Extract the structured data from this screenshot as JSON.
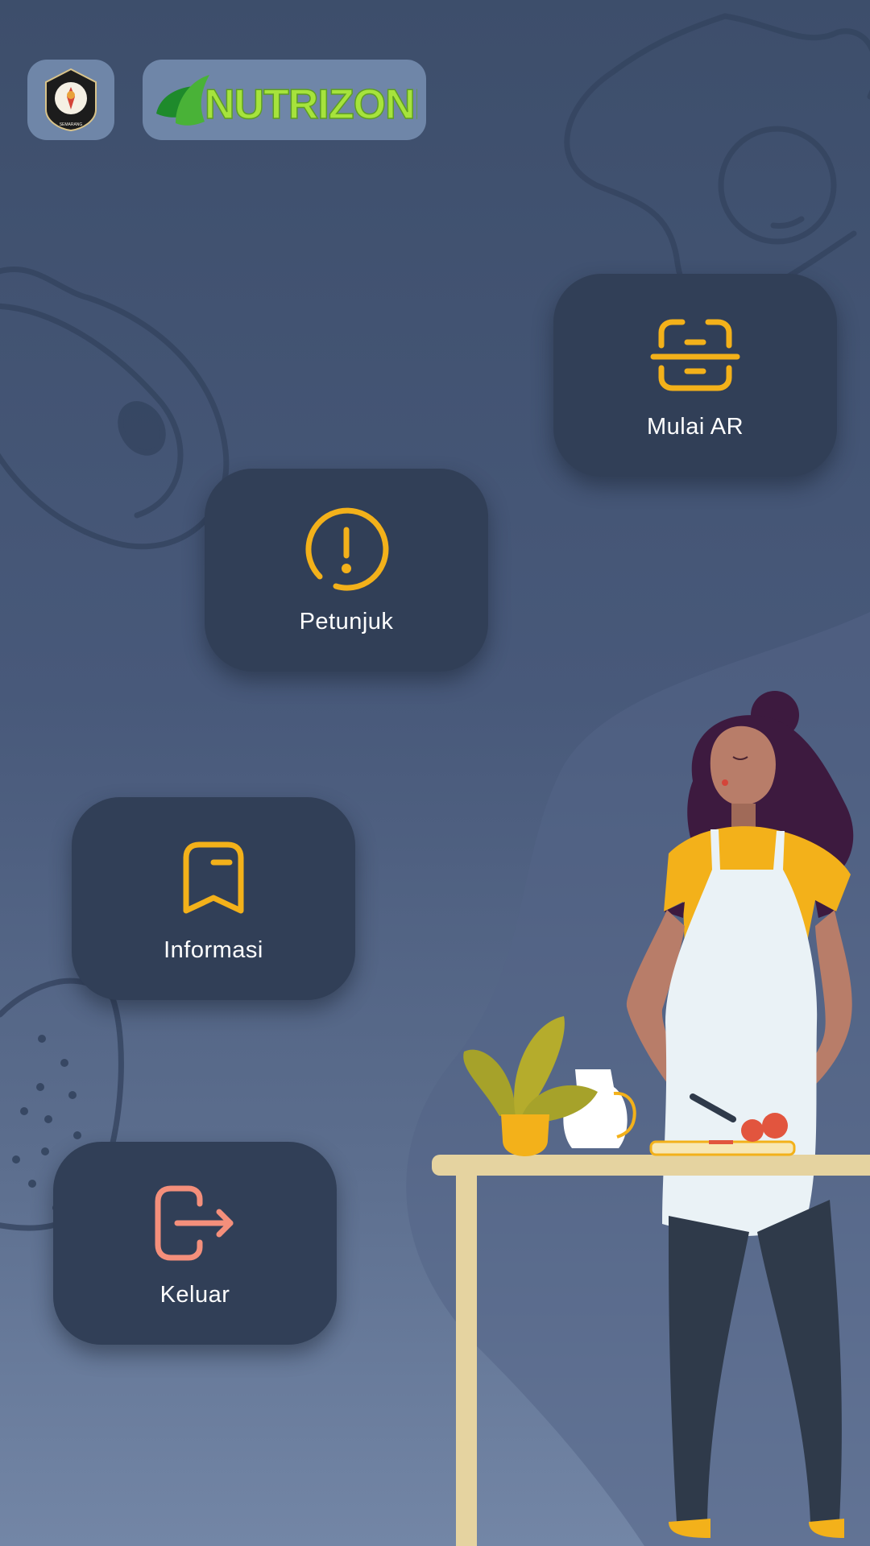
{
  "header": {
    "seal_text_top": "UNIVERSITAS DIPONEGORO",
    "seal_text_bottom": "SEMARANG",
    "brand_name": "NUTRIZONE"
  },
  "menu": {
    "items": [
      {
        "id": "ar",
        "label": "Mulai AR",
        "icon": "scan-icon"
      },
      {
        "id": "petunjuk",
        "label": "Petunjuk",
        "icon": "alert-circle-icon"
      },
      {
        "id": "informasi",
        "label": "Informasi",
        "icon": "bookmark-icon"
      },
      {
        "id": "keluar",
        "label": "Keluar",
        "icon": "logout-icon"
      }
    ]
  },
  "colors": {
    "background_top": "#3d4e6b",
    "background_bottom": "#7386a6",
    "card": "#313f57",
    "accent_yellow": "#f3b11a",
    "accent_salmon": "#f48f7b",
    "brand_green": "#a6e33c"
  }
}
